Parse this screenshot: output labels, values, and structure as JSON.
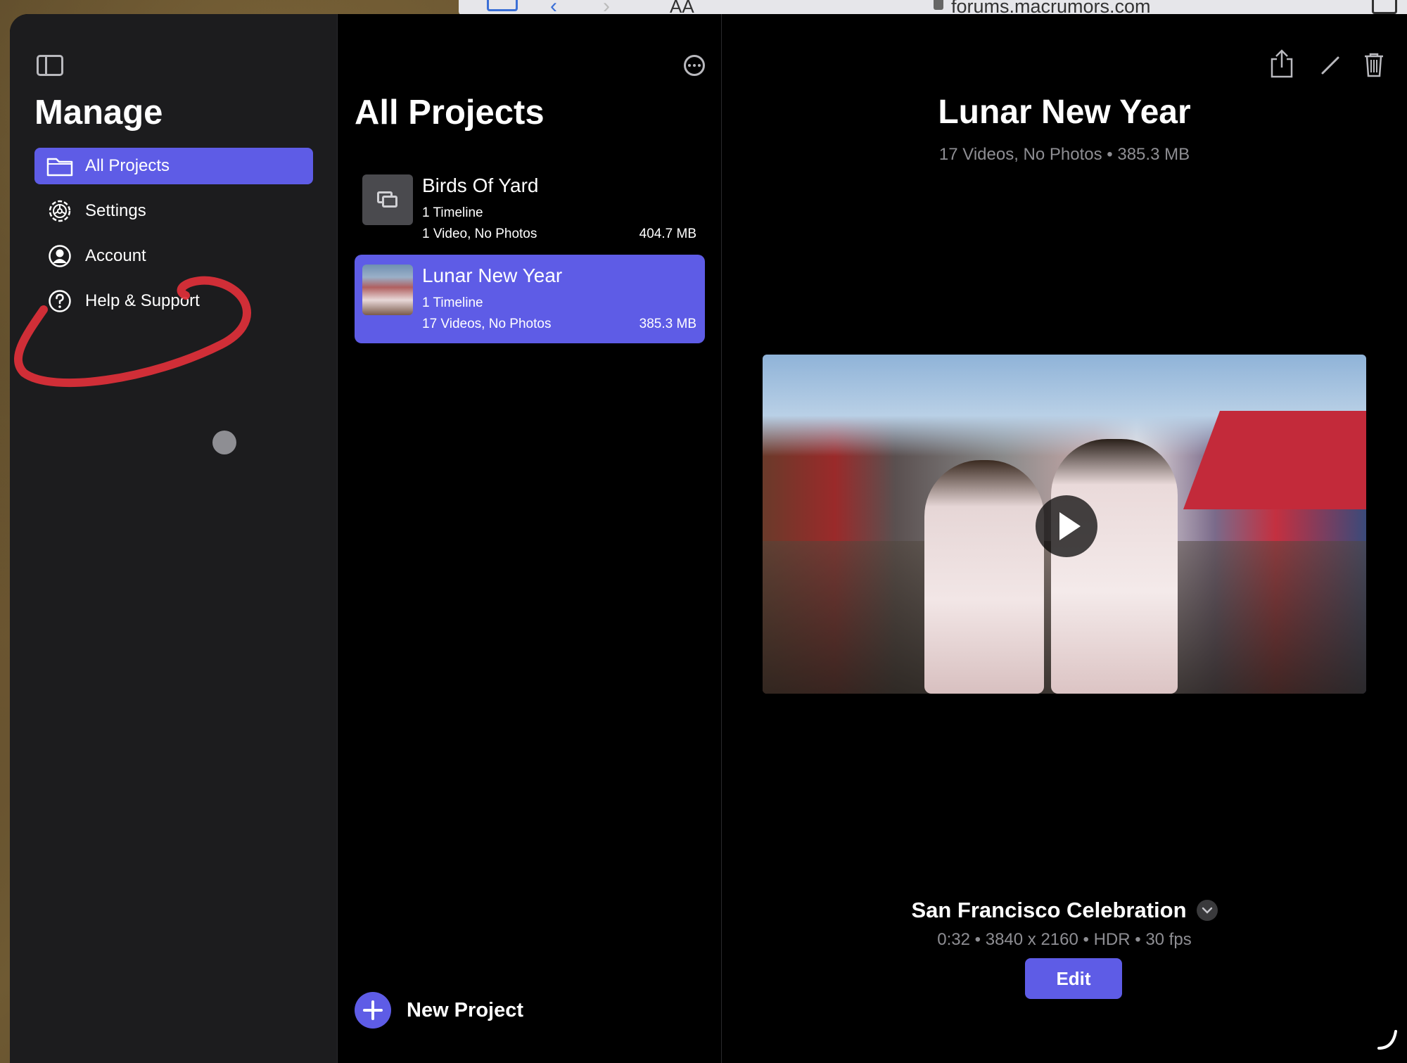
{
  "browser": {
    "url": "forums.macrumors.com",
    "text_size_label": "AA"
  },
  "sidebar": {
    "title": "Manage",
    "items": [
      {
        "label": "All Projects",
        "icon": "folder-icon",
        "active": true
      },
      {
        "label": "Settings",
        "icon": "gear-icon",
        "active": false
      },
      {
        "label": "Account",
        "icon": "account-icon",
        "active": false
      },
      {
        "label": "Help & Support",
        "icon": "help-icon",
        "active": false
      }
    ]
  },
  "projects": {
    "title": "All Projects",
    "list": [
      {
        "name": "Birds Of Yard",
        "timeline": "1 Timeline",
        "media": "1 Video, No Photos",
        "size": "404.7 MB",
        "selected": false
      },
      {
        "name": "Lunar New Year",
        "timeline": "1 Timeline",
        "media": "17 Videos, No Photos",
        "size": "385.3 MB",
        "selected": true
      }
    ],
    "new_project_label": "New Project"
  },
  "detail": {
    "title": "Lunar New Year",
    "subtitle": "17 Videos, No Photos • 385.3 MB",
    "clip_title": "San Francisco Celebration",
    "clip_meta": "0:32 • 3840 x 2160 • HDR • 30 fps",
    "edit_label": "Edit"
  },
  "colors": {
    "accent": "#5e5ce6",
    "sidebar_bg": "#1c1c1e",
    "secondary_text": "#8e8e93",
    "annotation": "#e0303a"
  }
}
